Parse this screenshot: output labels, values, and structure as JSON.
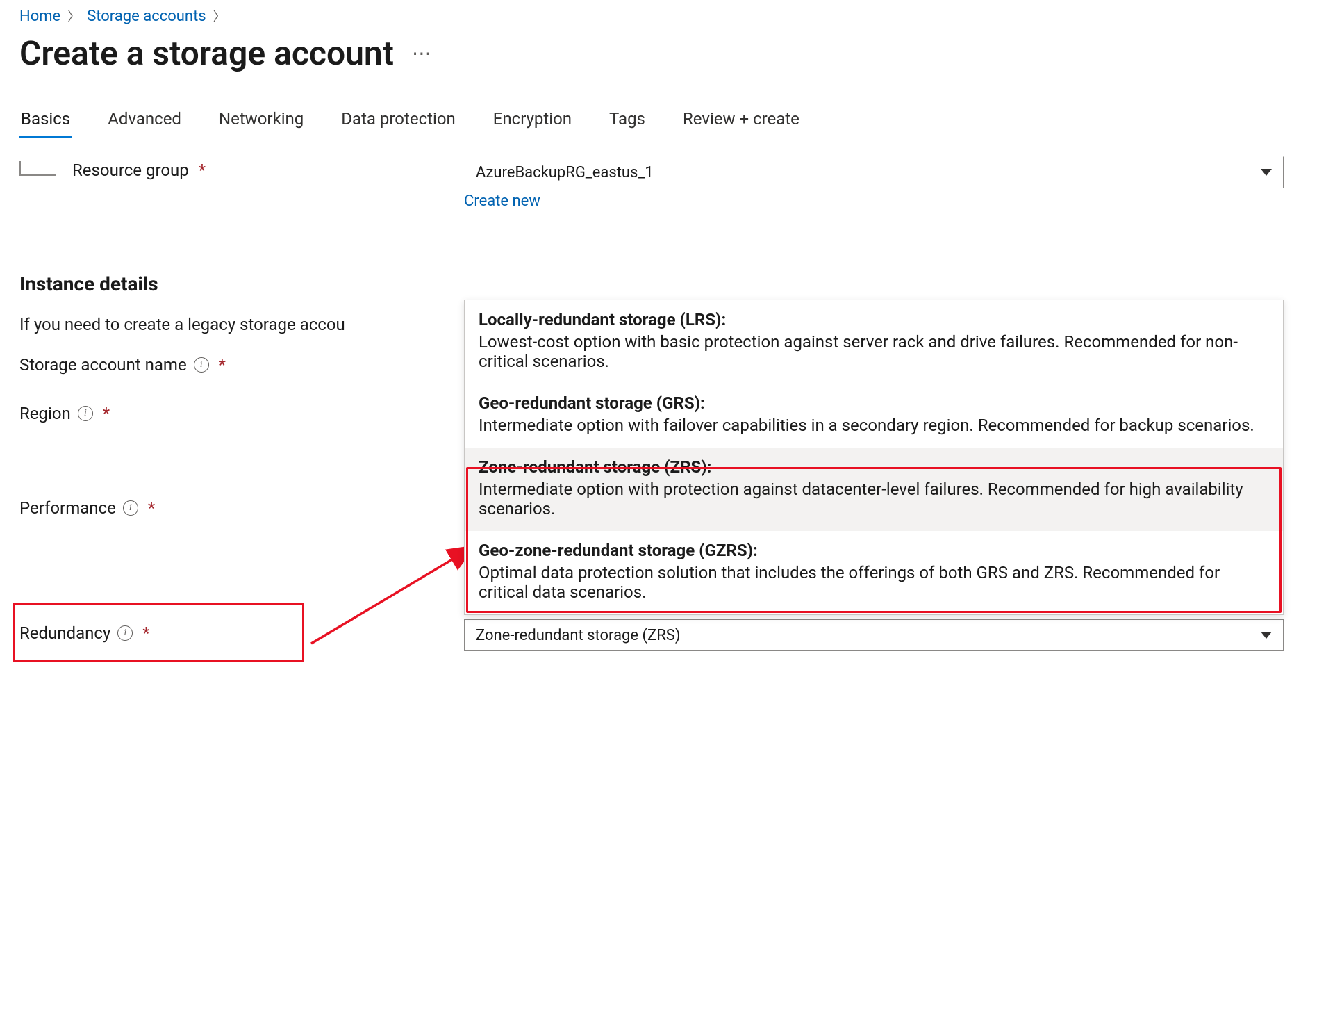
{
  "breadcrumb": {
    "items": [
      "Home",
      "Storage accounts"
    ]
  },
  "title": "Create a storage account",
  "tabs": [
    {
      "label": "Basics",
      "active": true
    },
    {
      "label": "Advanced"
    },
    {
      "label": "Networking"
    },
    {
      "label": "Data protection"
    },
    {
      "label": "Encryption"
    },
    {
      "label": "Tags"
    },
    {
      "label": "Review + create"
    }
  ],
  "resource_group": {
    "label": "Resource group",
    "value": "AzureBackupRG_eastus_1",
    "create_new": "Create new"
  },
  "section": {
    "heading": "Instance details",
    "description": "If you need to create a legacy storage accou"
  },
  "fields": {
    "storage_account_name": {
      "label": "Storage account name"
    },
    "region": {
      "label": "Region"
    },
    "performance": {
      "label": "Performance"
    },
    "redundancy": {
      "label": "Redundancy",
      "value": "Zone-redundant storage (ZRS)",
      "options": [
        {
          "title": "Locally-redundant storage (LRS):",
          "desc": "Lowest-cost option with basic protection against server rack and drive failures. Recommended for non-critical scenarios."
        },
        {
          "title": "Geo-redundant storage (GRS):",
          "desc": "Intermediate option with failover capabilities in a secondary region. Recommended for backup scenarios."
        },
        {
          "title": "Zone-redundant storage (ZRS):",
          "desc": "Intermediate option with protection against datacenter-level failures. Recommended for high availability scenarios.",
          "selected": true
        },
        {
          "title": "Geo-zone-redundant storage (GZRS):",
          "desc": "Optimal data protection solution that includes the offerings of both GRS and ZRS. Recommended for critical data scenarios."
        }
      ]
    }
  }
}
